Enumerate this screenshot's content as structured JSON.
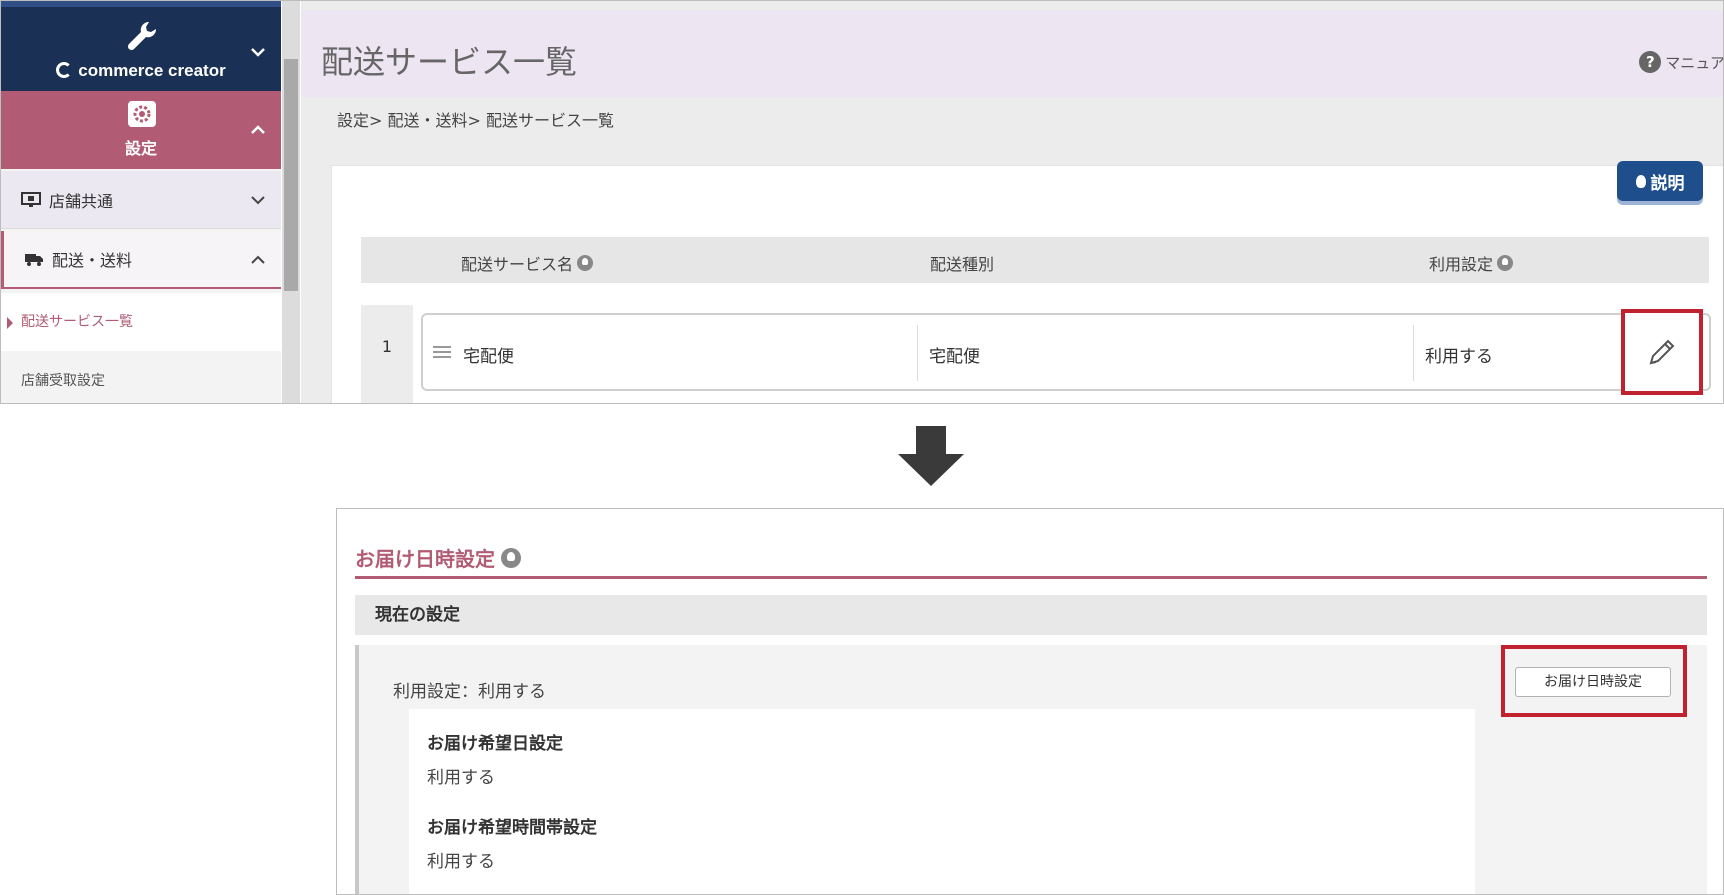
{
  "sidebar": {
    "brand": "commerce creator",
    "settings_label": "設定",
    "menu_store": "店舗共通",
    "menu_shipping": "配送・送料",
    "sub_active": "配送サービス一覧",
    "sub_next": "店舗受取設定"
  },
  "header": {
    "title": "配送サービス一覧",
    "manual": "マニュア"
  },
  "breadcrumb": "設定> 配送・送料> 配送サービス一覧",
  "help_badge": "説明",
  "table": {
    "headers": [
      "配送サービス名",
      "配送種別",
      "利用設定"
    ],
    "rows": [
      {
        "no": "1",
        "name": "宅配便",
        "type": "宅配便",
        "usage": "利用する"
      }
    ]
  },
  "detail": {
    "section_title": "お届け日時設定",
    "current_label": "現在の設定",
    "usage_line": "利用設定：利用する",
    "date_heading": "お届け希望日設定",
    "date_value": "利用する",
    "time_heading": "お届け希望時間帯設定",
    "time_value": "利用する",
    "button_label": "お届け日時設定"
  },
  "colors": {
    "brand_navy": "#1b3055",
    "accent_rose": "#b25b74",
    "highlight_red": "#c0232f",
    "help_blue": "#1f4e8c"
  }
}
